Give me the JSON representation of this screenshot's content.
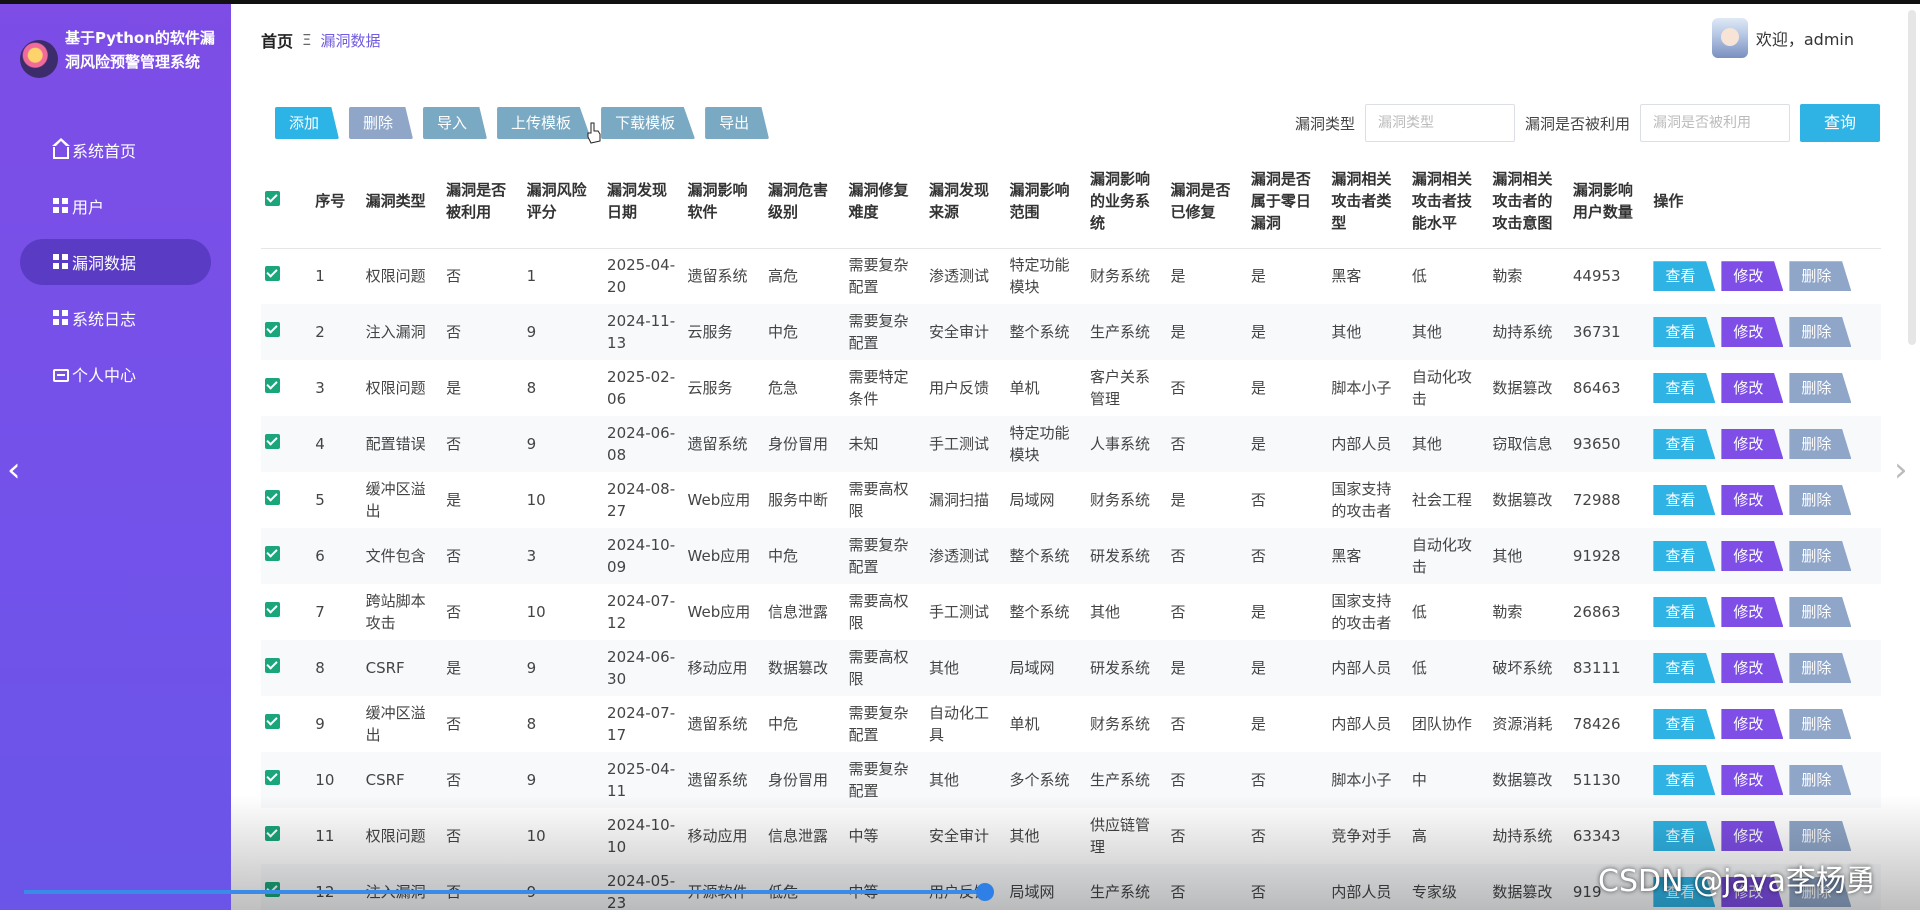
{
  "app": {
    "title": "基于Python的软件漏洞风险预警管理系统"
  },
  "sidebar": {
    "items": [
      {
        "label": "系统首页",
        "icon": "home-icon"
      },
      {
        "label": "用户",
        "icon": "grid-icon"
      },
      {
        "label": "漏洞数据",
        "icon": "grid-icon",
        "active": true
      },
      {
        "label": "系统日志",
        "icon": "grid-icon"
      },
      {
        "label": "个人中心",
        "icon": "card-icon"
      }
    ]
  },
  "header": {
    "breadcrumb_home": "首页",
    "breadcrumb_sep": "Ξ",
    "breadcrumb_current": "漏洞数据",
    "welcome": "欢迎，admin"
  },
  "toolbar": {
    "add": "添加",
    "delete": "删除",
    "import": "导入",
    "upload_template": "上传模板",
    "download_template": "下载模板",
    "export": "导出"
  },
  "filters": {
    "type_label": "漏洞类型",
    "type_placeholder": "漏洞类型",
    "exploited_label": "漏洞是否被利用",
    "exploited_placeholder": "漏洞是否被利用",
    "query": "查询"
  },
  "table": {
    "headers": [
      "序号",
      "漏洞类型",
      "漏洞是否被利用",
      "漏洞风险评分",
      "漏洞发现日期",
      "漏洞影响软件",
      "漏洞危害级别",
      "漏洞修复难度",
      "漏洞发现来源",
      "漏洞影响范围",
      "漏洞影响的业务系统",
      "漏洞是否已修复",
      "漏洞是否属于零日漏洞",
      "漏洞相关攻击者类型",
      "漏洞相关攻击者技能水平",
      "漏洞相关攻击者的攻击意图",
      "漏洞影响用户数量",
      "操作"
    ],
    "rows": [
      [
        "1",
        "权限问题",
        "否",
        "1",
        "2025-04-20",
        "遗留系统",
        "高危",
        "需要复杂配置",
        "渗透测试",
        "特定功能模块",
        "财务系统",
        "是",
        "是",
        "黑客",
        "低",
        "勒索",
        "44953"
      ],
      [
        "2",
        "注入漏洞",
        "否",
        "9",
        "2024-11-13",
        "云服务",
        "中危",
        "需要复杂配置",
        "安全审计",
        "整个系统",
        "生产系统",
        "是",
        "是",
        "其他",
        "其他",
        "劫持系统",
        "36731"
      ],
      [
        "3",
        "权限问题",
        "是",
        "8",
        "2025-02-06",
        "云服务",
        "危急",
        "需要特定条件",
        "用户反馈",
        "单机",
        "客户关系管理",
        "否",
        "是",
        "脚本小子",
        "自动化攻击",
        "数据篡改",
        "86463"
      ],
      [
        "4",
        "配置错误",
        "否",
        "9",
        "2024-06-08",
        "遗留系统",
        "身份冒用",
        "未知",
        "手工测试",
        "特定功能模块",
        "人事系统",
        "否",
        "是",
        "内部人员",
        "其他",
        "窃取信息",
        "93650"
      ],
      [
        "5",
        "缓冲区溢出",
        "是",
        "10",
        "2024-08-27",
        "Web应用",
        "服务中断",
        "需要高权限",
        "漏洞扫描",
        "局域网",
        "财务系统",
        "是",
        "否",
        "国家支持的攻击者",
        "社会工程",
        "数据篡改",
        "72988"
      ],
      [
        "6",
        "文件包含",
        "否",
        "3",
        "2024-10-09",
        "Web应用",
        "中危",
        "需要复杂配置",
        "渗透测试",
        "整个系统",
        "研发系统",
        "否",
        "否",
        "黑客",
        "自动化攻击",
        "其他",
        "91928"
      ],
      [
        "7",
        "跨站脚本攻击",
        "否",
        "10",
        "2024-07-12",
        "Web应用",
        "信息泄露",
        "需要高权限",
        "手工测试",
        "整个系统",
        "其他",
        "否",
        "是",
        "国家支持的攻击者",
        "低",
        "勒索",
        "26863"
      ],
      [
        "8",
        "CSRF",
        "是",
        "9",
        "2024-06-30",
        "移动应用",
        "数据篡改",
        "需要高权限",
        "其他",
        "局域网",
        "研发系统",
        "是",
        "是",
        "内部人员",
        "低",
        "破坏系统",
        "83111"
      ],
      [
        "9",
        "缓冲区溢出",
        "否",
        "8",
        "2024-07-17",
        "遗留系统",
        "中危",
        "需要复杂配置",
        "自动化工具",
        "单机",
        "财务系统",
        "否",
        "是",
        "内部人员",
        "团队协作",
        "资源消耗",
        "78426"
      ],
      [
        "10",
        "CSRF",
        "否",
        "9",
        "2025-04-11",
        "遗留系统",
        "身份冒用",
        "需要复杂配置",
        "其他",
        "多个系统",
        "生产系统",
        "否",
        "否",
        "脚本小子",
        "中",
        "数据篡改",
        "51130"
      ],
      [
        "11",
        "权限问题",
        "否",
        "10",
        "2024-10-10",
        "移动应用",
        "信息泄露",
        "中等",
        "安全审计",
        "其他",
        "供应链管理",
        "否",
        "否",
        "竞争对手",
        "高",
        "劫持系统",
        "63343"
      ],
      [
        "12",
        "注入漏洞",
        "否",
        "9",
        "2024-05-23",
        "开源软件",
        "低危",
        "中等",
        "用户反馈",
        "局域网",
        "生产系统",
        "否",
        "否",
        "内部人员",
        "专家级",
        "数据篡改",
        "919"
      ]
    ],
    "ops": {
      "view": "查看",
      "edit": "修改",
      "delete": "删除"
    }
  },
  "watermark": "CSDN @java李杨勇",
  "colors": {
    "sidebar": "#7a4fe6",
    "primary": "#2fb3e4",
    "edit": "#7e4ee6",
    "muted": "#8fa6c8",
    "check": "#1aa57a"
  }
}
